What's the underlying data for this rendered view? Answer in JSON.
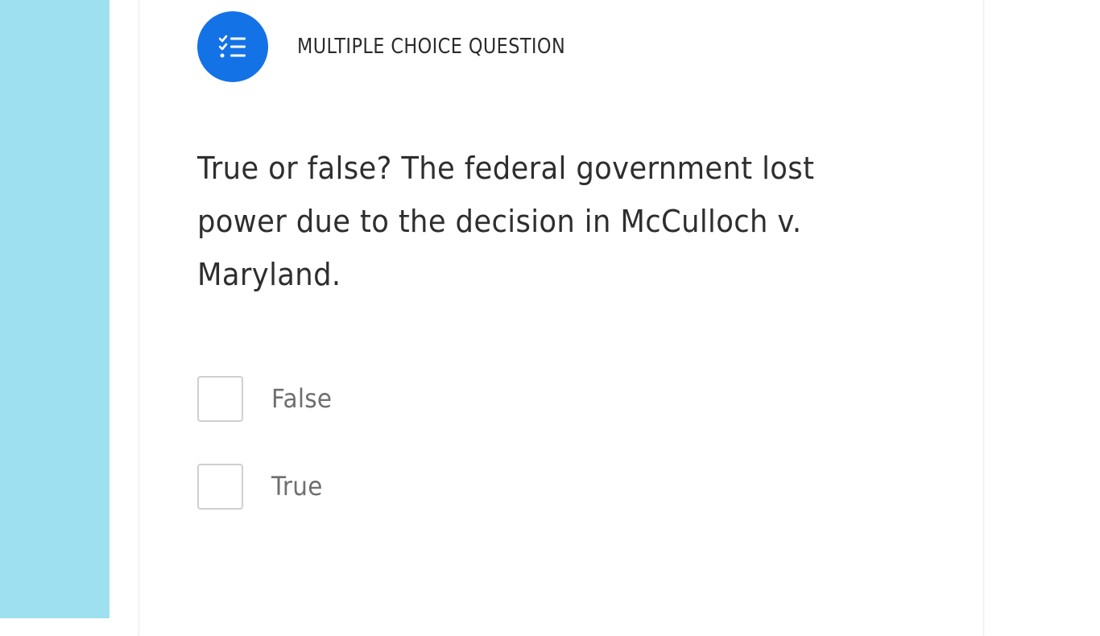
{
  "question": {
    "type_label": "MULTIPLE CHOICE QUESTION",
    "type_icon": "checklist-icon",
    "text": "True or false? The federal government lost power due to the decision in McCulloch v. Maryland.",
    "choices": [
      {
        "label": "False",
        "checked": false
      },
      {
        "label": "True",
        "checked": false
      }
    ]
  },
  "colors": {
    "side_strip": "#9ee0ef",
    "accent": "#1372e6",
    "text": "#2e2e2e",
    "choice_text": "#6f6f6f"
  }
}
